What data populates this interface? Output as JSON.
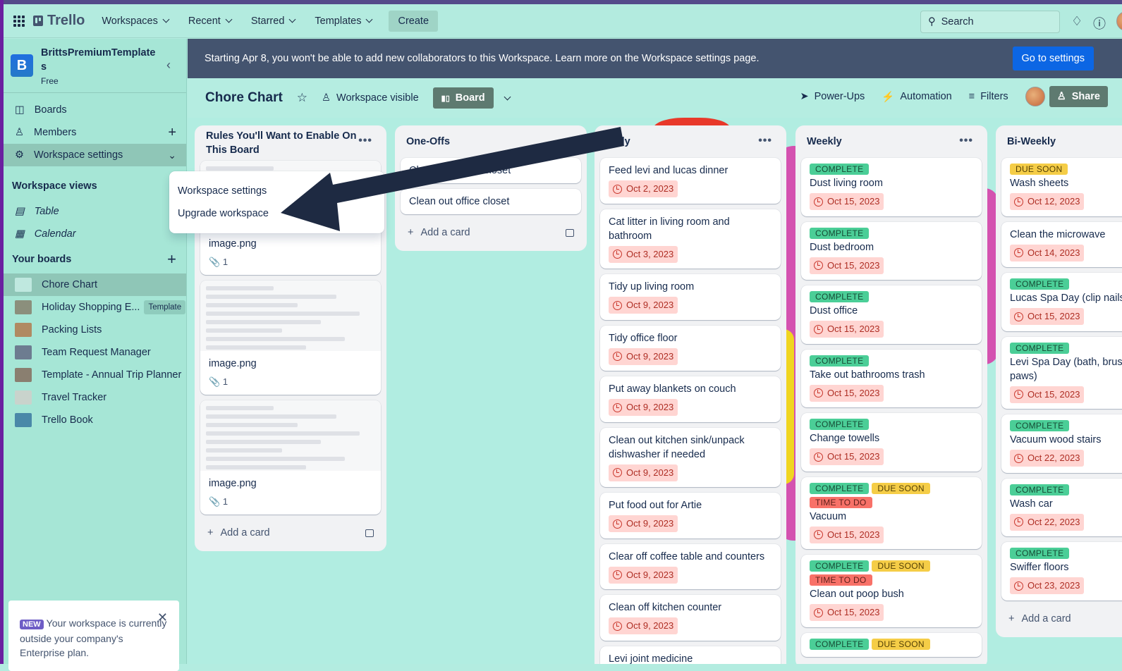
{
  "topbar": {
    "logo": "Trello",
    "nav": [
      "Workspaces",
      "Recent",
      "Starred",
      "Templates"
    ],
    "create": "Create",
    "search_placeholder": "Search"
  },
  "sidebar": {
    "workspace_name": "BrittsPremiumTemplates",
    "workspace_initial": "B",
    "plan": "Free",
    "items": [
      {
        "label": "Boards",
        "icon": "board-icon"
      },
      {
        "label": "Members",
        "icon": "person-icon"
      },
      {
        "label": "Workspace settings",
        "icon": "gear-icon"
      }
    ],
    "views_title": "Workspace views",
    "views": [
      {
        "label": "Table",
        "icon": "table-icon"
      },
      {
        "label": "Calendar",
        "icon": "calendar-icon"
      }
    ],
    "boards_title": "Your boards",
    "boards": [
      {
        "label": "Chore Chart",
        "color": "#bfe8df"
      },
      {
        "label": "Holiday Shopping E...",
        "badge": "Template",
        "color": "#8b8f7c"
      },
      {
        "label": "Packing Lists",
        "color": "#b08a62"
      },
      {
        "label": "Team Request Manager",
        "color": "#6d7c90"
      },
      {
        "label": "Template - Annual Trip Planner",
        "color": "#8a7f70"
      },
      {
        "label": "Travel Tracker",
        "color": "#c9d3cc"
      },
      {
        "label": "Trello Book",
        "color": "#4a88a8"
      }
    ],
    "notice": {
      "badge": "NEW",
      "text": "Your workspace is currently outside your company's Enterprise plan."
    }
  },
  "banner": {
    "text": "Starting Apr 8, you won't be able to add new collaborators to this Workspace. Learn more on the Workspace settings page.",
    "button": "Go to settings"
  },
  "board": {
    "title": "Chore Chart",
    "visibility": "Workspace visible",
    "view": "Board",
    "powerups": "Power-Ups",
    "automation": "Automation",
    "filters": "Filters",
    "share": "Share"
  },
  "popup": {
    "items": [
      "Workspace settings",
      "Upgrade workspace"
    ]
  },
  "add_card": "Add a card",
  "colors": {
    "complete": "#4bce97",
    "due_soon": "#f5cd47",
    "time_to_do": "#f87168",
    "banner": "#44546f",
    "accent": "#0c66e4"
  },
  "lists": [
    {
      "title": "Rules You'll Want to Enable On This Board",
      "cards": [
        {
          "title": "image.png",
          "attachments": "1",
          "image": true
        },
        {
          "title": "image.png",
          "attachments": "1",
          "image": true
        },
        {
          "title": "image.png",
          "attachments": "1",
          "image": true
        }
      ]
    },
    {
      "title": "One-Offs",
      "cards": [
        {
          "title": "Clean out porch closet"
        },
        {
          "title": "Clean out office closet"
        }
      ]
    },
    {
      "title": "Daily",
      "cards": [
        {
          "title": "Feed levi and lucas dinner",
          "due": "Oct 2, 2023"
        },
        {
          "title": "Cat litter in living room and bathroom",
          "due": "Oct 3, 2023"
        },
        {
          "title": "Tidy up living room",
          "due": "Oct 9, 2023"
        },
        {
          "title": "Tidy office floor",
          "due": "Oct 9, 2023"
        },
        {
          "title": "Put away blankets on couch",
          "due": "Oct 9, 2023"
        },
        {
          "title": "Clean out kitchen sink/unpack dishwasher if needed",
          "due": "Oct 9, 2023"
        },
        {
          "title": "Put food out for Artie",
          "due": "Oct 9, 2023"
        },
        {
          "title": "Clear off coffee table and counters",
          "due": "Oct 9, 2023"
        },
        {
          "title": "Clean off kitchen counter",
          "due": "Oct 9, 2023"
        },
        {
          "title": "Levi joint medicine"
        }
      ]
    },
    {
      "title": "Weekly",
      "cards": [
        {
          "labels": [
            "COMPLETE"
          ],
          "title": "Dust living room",
          "due": "Oct 15, 2023"
        },
        {
          "labels": [
            "COMPLETE"
          ],
          "title": "Dust bedroom",
          "due": "Oct 15, 2023"
        },
        {
          "labels": [
            "COMPLETE"
          ],
          "title": "Dust office",
          "due": "Oct 15, 2023"
        },
        {
          "labels": [
            "COMPLETE"
          ],
          "title": "Take out bathrooms trash",
          "due": "Oct 15, 2023"
        },
        {
          "labels": [
            "COMPLETE"
          ],
          "title": "Change towells",
          "due": "Oct 15, 2023"
        },
        {
          "labels": [
            "COMPLETE",
            "DUE SOON",
            "TIME TO DO"
          ],
          "title": "Vacuum",
          "due": "Oct 15, 2023"
        },
        {
          "labels": [
            "COMPLETE",
            "DUE SOON",
            "TIME TO DO"
          ],
          "title": "Clean out poop bush",
          "due": "Oct 15, 2023"
        },
        {
          "labels": [
            "COMPLETE",
            "DUE SOON"
          ]
        }
      ]
    },
    {
      "title": "Bi-Weekly",
      "add": true,
      "cards": [
        {
          "labels": [
            "DUE SOON"
          ],
          "title": "Wash sheets",
          "due": "Oct 12, 2023"
        },
        {
          "title": "Clean the microwave",
          "due": "Oct 14, 2023"
        },
        {
          "labels": [
            "COMPLETE"
          ],
          "title": "Lucas Spa Day (clip nails teeth)",
          "due": "Oct 15, 2023"
        },
        {
          "labels": [
            "COMPLETE"
          ],
          "title": "Levi Spa Day (bath, brush stuff on paws)",
          "due": "Oct 15, 2023"
        },
        {
          "labels": [
            "COMPLETE"
          ],
          "title": "Vacuum wood stairs",
          "due": "Oct 22, 2023"
        },
        {
          "labels": [
            "COMPLETE"
          ],
          "title": "Wash car",
          "due": "Oct 22, 2023"
        },
        {
          "labels": [
            "COMPLETE"
          ],
          "title": "Swiffer floors",
          "due": "Oct 23, 2023"
        }
      ]
    }
  ]
}
